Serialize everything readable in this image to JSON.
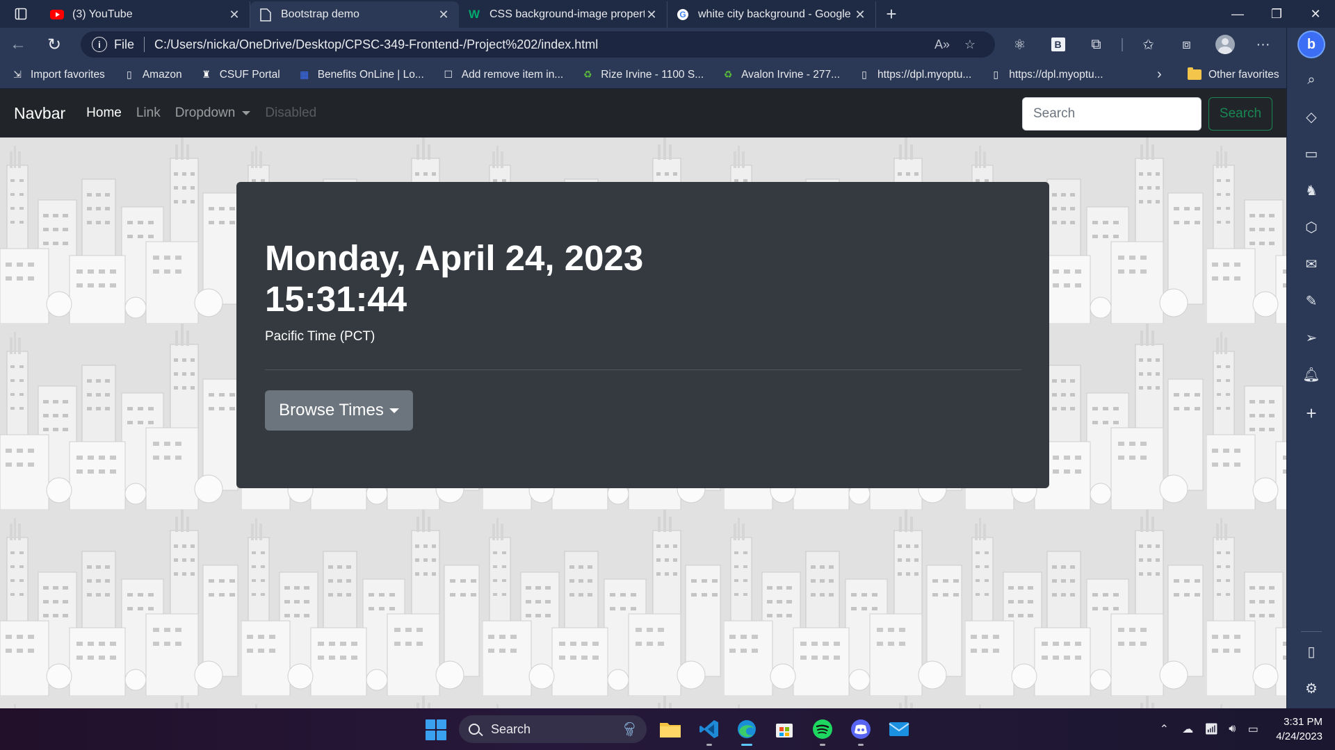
{
  "browser": {
    "tabs": [
      {
        "title": "(3) YouTube",
        "icon": "youtube-icon",
        "active": false
      },
      {
        "title": "Bootstrap demo",
        "icon": "page-icon",
        "active": true
      },
      {
        "title": "CSS background-image property",
        "icon": "w3schools-icon",
        "active": false
      },
      {
        "title": "white city background - Google S",
        "icon": "google-icon",
        "active": false
      }
    ],
    "address": {
      "scheme_label": "File",
      "url": "C:/Users/nicka/OneDrive/Desktop/CPSC-349-Frontend-/Project%202/index.html"
    },
    "favorites": [
      {
        "label": "Import favorites",
        "icon": "import-icon"
      },
      {
        "label": "Amazon",
        "icon": "page-icon"
      },
      {
        "label": "CSUF Portal",
        "icon": "csuf-icon"
      },
      {
        "label": "Benefits OnLine | Lo...",
        "icon": "benefits-icon"
      },
      {
        "label": "Add remove item in...",
        "icon": "checkbox-icon"
      },
      {
        "label": "Rize Irvine - 1100 S...",
        "icon": "recycle-icon"
      },
      {
        "label": "Avalon Irvine - 277...",
        "icon": "recycle-icon"
      },
      {
        "label": "https://dpl.myoptu...",
        "icon": "page-icon"
      },
      {
        "label": "https://dpl.myoptu...",
        "icon": "page-icon"
      }
    ],
    "other_favorites": "Other favorites"
  },
  "page": {
    "navbar": {
      "brand": "Navbar",
      "links": [
        "Home",
        "Link",
        "Dropdown",
        "Disabled"
      ],
      "search_placeholder": "Search",
      "search_button": "Search"
    },
    "card": {
      "date": "Monday, April 24, 2023",
      "time": "15:31:44",
      "timezone": "Pacific Time (PCT)",
      "button": "Browse Times"
    }
  },
  "taskbar": {
    "search_label": "Search",
    "clock_time": "3:31 PM",
    "clock_date": "4/24/2023"
  },
  "colors": {
    "navbar_bg": "#212529",
    "card_bg": "#343a40",
    "button_bg": "#6c757d",
    "success": "#198754",
    "browser_chrome": "#2b3956"
  }
}
